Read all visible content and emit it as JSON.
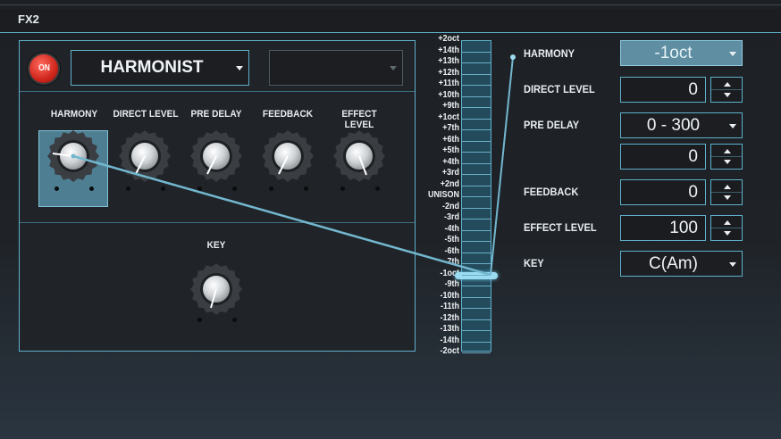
{
  "window": {
    "title": "FX2"
  },
  "effect": {
    "on_label": "ON",
    "type": "HARMONIST",
    "secondary_select": ""
  },
  "knobs": [
    {
      "id": "harmony",
      "label": "HARMONY"
    },
    {
      "id": "direct-level",
      "label": "DIRECT LEVEL"
    },
    {
      "id": "pre-delay",
      "label": "PRE DELAY"
    },
    {
      "id": "feedback",
      "label": "FEEDBACK"
    },
    {
      "id": "effect-level",
      "label": "EFFECT LEVEL"
    }
  ],
  "key_knob": {
    "label": "KEY"
  },
  "harmony_scale": {
    "ticks": [
      "+2oct",
      "+14th",
      "+13th",
      "+12th",
      "+11th",
      "+10th",
      "+9th",
      "+1oct",
      "+7th",
      "+6th",
      "+5th",
      "+4th",
      "+3rd",
      "+2nd",
      "UNISON",
      "-2nd",
      "-3rd",
      "-4th",
      "-5th",
      "-6th",
      "-7th",
      "-1oct",
      "-9th",
      "-10th",
      "-11th",
      "-12th",
      "-13th",
      "-14th",
      "-2oct"
    ],
    "selected": "-1oct"
  },
  "params": {
    "harmony": {
      "label": "HARMONY",
      "value": "-1oct"
    },
    "direct_level": {
      "label": "DIRECT LEVEL",
      "value": "0"
    },
    "pre_delay": {
      "label": "PRE DELAY",
      "range": "0 - 300",
      "value": "0"
    },
    "feedback": {
      "label": "FEEDBACK",
      "value": "0"
    },
    "effect_level": {
      "label": "EFFECT LEVEL",
      "value": "100"
    },
    "key": {
      "label": "KEY",
      "value": "C(Am)"
    }
  },
  "colors": {
    "accent": "#5fb1cc",
    "highlight": "#4e7e92",
    "on_button": "#d0261c",
    "thumb": "#9bdcf2"
  }
}
